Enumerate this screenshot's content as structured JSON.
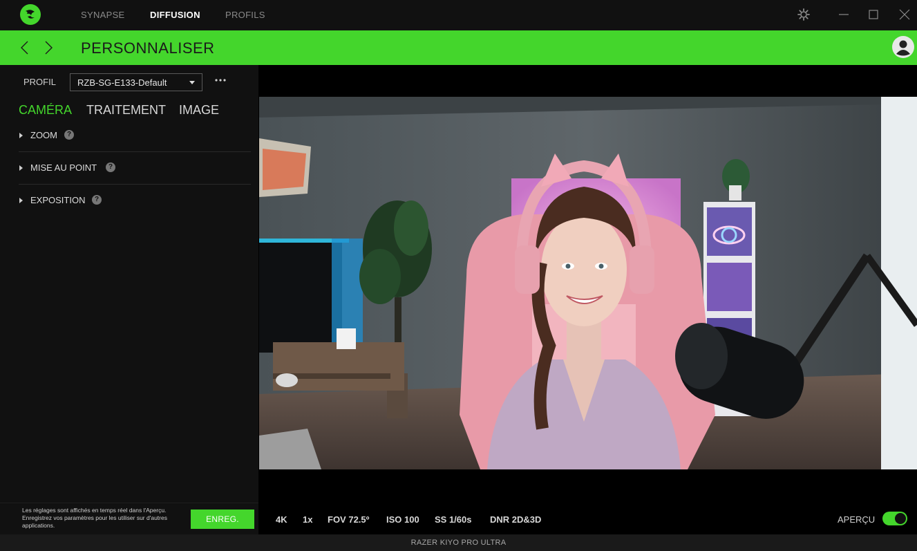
{
  "nav": {
    "items": [
      "SYNAPSE",
      "DIFFUSION",
      "PROFILS"
    ],
    "active": "DIFFUSION"
  },
  "header": {
    "title": "PERSONNALISER"
  },
  "profile": {
    "label": "PROFIL",
    "selected": "RZB-SG-E133-Default"
  },
  "tabs": [
    {
      "label": "CAMÉRA",
      "active": true
    },
    {
      "label": "TRAITEMENT",
      "active": false
    },
    {
      "label": "IMAGE",
      "active": false
    }
  ],
  "sections": [
    {
      "label": "ZOOM"
    },
    {
      "label": "MISE AU POINT"
    },
    {
      "label": "EXPOSITION"
    }
  ],
  "info": {
    "text": "Les réglages sont affichés en temps réel dans l'Aperçu. Enregistrez vos paramètres pour les utiliser sur d'autres applications.",
    "save_label": "ENREG."
  },
  "stats": [
    "4K",
    "1x",
    "FOV 72.5º",
    "ISO 100",
    "SS 1/60s",
    "DNR 2D&3D"
  ],
  "preview_toggle": {
    "label": "APERÇU",
    "on": true
  },
  "status": {
    "device": "RAZER KIYO PRO ULTRA"
  },
  "colors": {
    "accent": "#44d62c",
    "background": "#000000",
    "panel": "#111111"
  }
}
